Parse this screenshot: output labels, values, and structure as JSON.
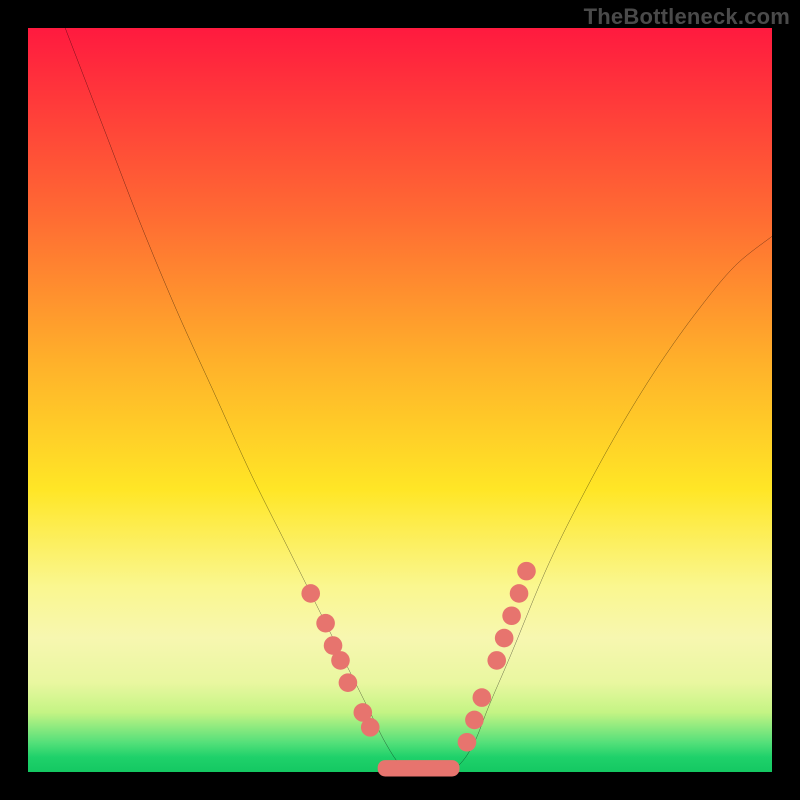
{
  "watermark": "TheBottleneck.com",
  "colors": {
    "background": "#000000",
    "curve": "#000000",
    "markers": "#e7746e",
    "band": "#e7746e"
  },
  "chart_data": {
    "type": "line",
    "title": "",
    "xlabel": "",
    "ylabel": "",
    "xlim": [
      0,
      100
    ],
    "ylim": [
      0,
      100
    ],
    "grid": false,
    "legend": false,
    "series": [
      {
        "name": "bottleneck-curve",
        "x": [
          5,
          10,
          15,
          20,
          25,
          30,
          35,
          38,
          40,
          42,
          44,
          46,
          48,
          50,
          52,
          54,
          56,
          58,
          60,
          62,
          65,
          70,
          75,
          80,
          85,
          90,
          95,
          100
        ],
        "y": [
          100,
          87,
          74,
          62,
          51,
          40,
          30,
          24,
          20,
          16,
          12,
          8,
          4,
          1,
          0,
          0,
          0,
          1,
          4,
          9,
          16,
          28,
          38,
          47,
          55,
          62,
          68,
          72
        ]
      }
    ],
    "markers": {
      "name": "salmon-points",
      "comment": "visible salmon dots near the valley on both sides",
      "points": [
        {
          "x": 38,
          "y": 24
        },
        {
          "x": 40,
          "y": 20
        },
        {
          "x": 41,
          "y": 17
        },
        {
          "x": 42,
          "y": 15
        },
        {
          "x": 43,
          "y": 12
        },
        {
          "x": 45,
          "y": 8
        },
        {
          "x": 46,
          "y": 6
        },
        {
          "x": 59,
          "y": 4
        },
        {
          "x": 60,
          "y": 7
        },
        {
          "x": 61,
          "y": 10
        },
        {
          "x": 63,
          "y": 15
        },
        {
          "x": 64,
          "y": 18
        },
        {
          "x": 65,
          "y": 21
        },
        {
          "x": 66,
          "y": 24
        },
        {
          "x": 67,
          "y": 27
        }
      ]
    },
    "valley_band": {
      "x_start": 47,
      "x_end": 58,
      "y": 0.5,
      "thickness": 2.2
    }
  }
}
